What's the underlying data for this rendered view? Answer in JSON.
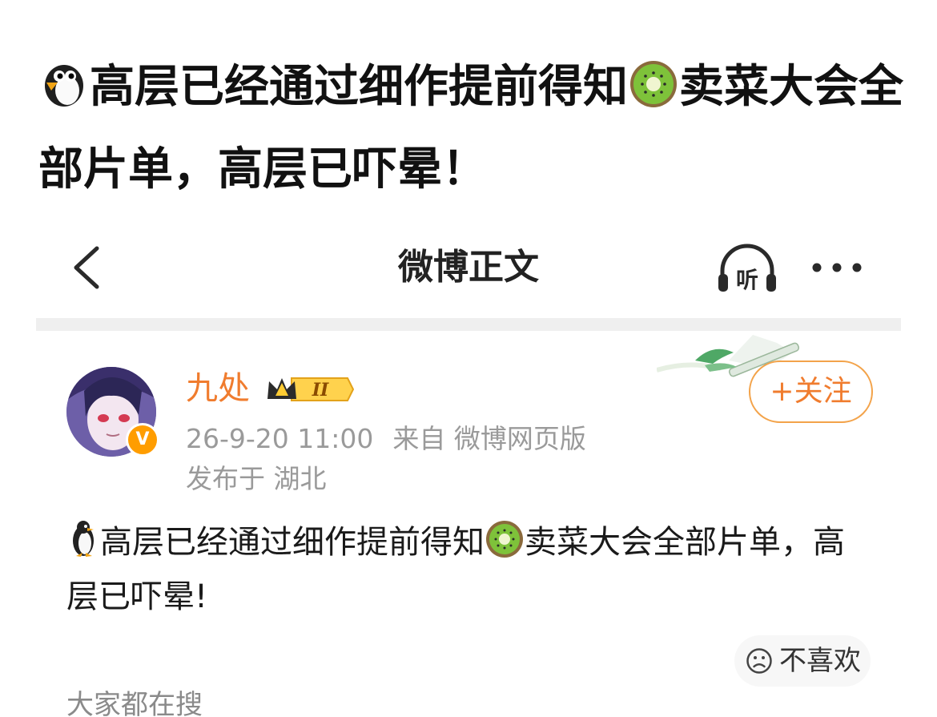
{
  "headline": {
    "part1": "高层已经通过细作提前得知",
    "part2": "卖菜大会全部片单，高层已吓晕！",
    "emoji1": "penguin-icon",
    "emoji2": "kiwi-icon"
  },
  "nav": {
    "title": "微博正文",
    "listen_label": "听"
  },
  "post": {
    "author_name": "九处",
    "vip_level": "II",
    "verified_mark": "V",
    "timestamp": "26-9-20 11:00",
    "source": "来自 微博网页版",
    "location": "发布于 湖北",
    "text_part1": "高层已经通过细作提前得知",
    "text_part2": "卖菜大会全部片单，高层已吓晕!"
  },
  "actions": {
    "follow_label": "+关注",
    "dislike_label": "不喜欢"
  },
  "footer": {
    "hot_search_label": "大家都在搜"
  },
  "colors": {
    "accent_orange": "#f07c2e",
    "follow_border": "#f3a34a",
    "meta_gray": "#9a9a9a",
    "divider": "#efefef"
  }
}
